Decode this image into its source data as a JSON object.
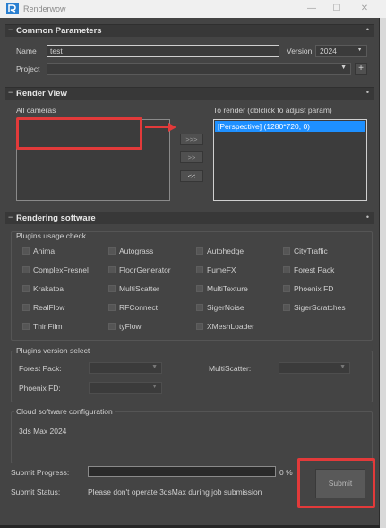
{
  "window": {
    "title": "Renderwow",
    "minimize_glyph": "—",
    "maximize_glyph": "☐",
    "close_glyph": "✕"
  },
  "common_parameters": {
    "title": "Common Parameters",
    "collapse_glyph": "−",
    "name_label": "Name",
    "name_value": "test",
    "version_label": "Version",
    "version_value": "2024",
    "project_label": "Project",
    "project_value": "",
    "add_glyph": "+"
  },
  "render_view": {
    "title": "Render View",
    "collapse_glyph": "−",
    "all_cameras_label": "All cameras",
    "all_cameras_items": [],
    "to_render_label": "To render (dblclick to adjust param)",
    "to_render_items": [
      "[Perspective] (1280*720, 0)"
    ],
    "add_all_label": ">>>",
    "add_label": ">>",
    "remove_label": "<<"
  },
  "rendering_software": {
    "title": "Rendering software",
    "collapse_glyph": "−",
    "plugins_usage_title": "Plugins usage check",
    "plugins": [
      [
        "Anima",
        "Autograss",
        "Autohedge",
        "CityTraffic"
      ],
      [
        "ComplexFresnel",
        "FloorGenerator",
        "FumeFX",
        "Forest Pack"
      ],
      [
        "Krakatoa",
        "MultiScatter",
        "MultiTexture",
        "Phoenix FD"
      ],
      [
        "RealFlow",
        "RFConnect",
        "SigerNoise",
        "SigerScratches"
      ],
      [
        "ThinFilm",
        "tyFlow",
        "XMeshLoader"
      ]
    ],
    "plugins_version_title": "Plugins version select",
    "forest_pack_label": "Forest Pack:",
    "forest_pack_value": "",
    "multiscatter_label": "MultiScatter:",
    "multiscatter_value": "",
    "phoenix_label": "Phoenix FD:",
    "phoenix_value": "",
    "cloud_config_title": "Cloud software configuration",
    "cloud_config_value": "3ds Max 2024"
  },
  "submit": {
    "progress_label": "Submit Progress:",
    "progress_value": 0,
    "progress_text": "0 %",
    "status_label": "Submit Status:",
    "status_text": "Please don't operate 3dsMax during job submission",
    "submit_label": "Submit"
  },
  "colors": {
    "highlight": "#e23a3a",
    "selection": "#1e90ff"
  }
}
